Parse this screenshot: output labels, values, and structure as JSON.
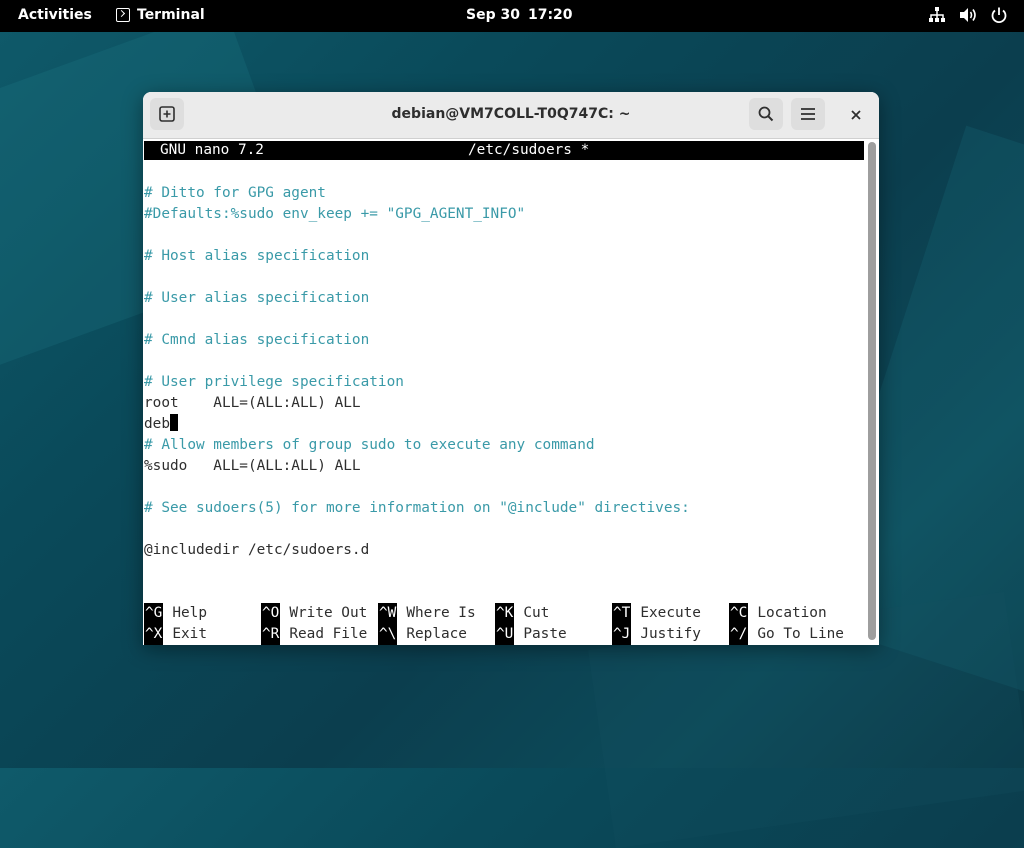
{
  "topbar": {
    "activities": "Activities",
    "app_name": "Terminal",
    "date": "Sep 30",
    "time": "17:20",
    "tray_icons": [
      "network-icon",
      "volume-icon",
      "power-icon"
    ]
  },
  "window": {
    "title": "debian@VM7COLL-T0Q747C: ~",
    "buttons": [
      "new-tab-icon",
      "search-icon",
      "menu-icon",
      "close-icon"
    ]
  },
  "nano": {
    "version": "GNU nano 7.2",
    "filename": "/etc/sudoers *",
    "lines": [
      {
        "text": "# Ditto for GPG agent",
        "comment": true
      },
      {
        "text": "#Defaults:%sudo env_keep += \"GPG_AGENT_INFO\"",
        "comment": true
      },
      {
        "text": "",
        "comment": false
      },
      {
        "text": "# Host alias specification",
        "comment": true
      },
      {
        "text": "",
        "comment": false
      },
      {
        "text": "# User alias specification",
        "comment": true
      },
      {
        "text": "",
        "comment": false
      },
      {
        "text": "# Cmnd alias specification",
        "comment": true
      },
      {
        "text": "",
        "comment": false
      },
      {
        "text": "# User privilege specification",
        "comment": true
      },
      {
        "text": "root    ALL=(ALL:ALL) ALL",
        "comment": false
      },
      {
        "text": "deb",
        "comment": false,
        "cursor": true
      },
      {
        "text": "# Allow members of group sudo to execute any command",
        "comment": true
      },
      {
        "text": "%sudo   ALL=(ALL:ALL) ALL",
        "comment": false
      },
      {
        "text": "",
        "comment": false
      },
      {
        "text": "# See sudoers(5) for more information on \"@include\" directives:",
        "comment": true
      },
      {
        "text": "",
        "comment": false
      },
      {
        "text": "@includedir /etc/sudoers.d",
        "comment": false
      }
    ],
    "shortcuts_row1": [
      {
        "key": "^G",
        "label": "Help"
      },
      {
        "key": "^O",
        "label": "Write Out"
      },
      {
        "key": "^W",
        "label": "Where Is"
      },
      {
        "key": "^K",
        "label": "Cut"
      },
      {
        "key": "^T",
        "label": "Execute"
      },
      {
        "key": "^C",
        "label": "Location"
      }
    ],
    "shortcuts_row2": [
      {
        "key": "^X",
        "label": "Exit"
      },
      {
        "key": "^R",
        "label": "Read File"
      },
      {
        "key": "^\\",
        "label": "Replace"
      },
      {
        "key": "^U",
        "label": "Paste"
      },
      {
        "key": "^J",
        "label": "Justify"
      },
      {
        "key": "^/",
        "label": "Go To Line"
      }
    ]
  },
  "colors": {
    "comment": "#3a9aa8",
    "text": "#2e2e2e",
    "title_bar_bg": "#000000"
  }
}
